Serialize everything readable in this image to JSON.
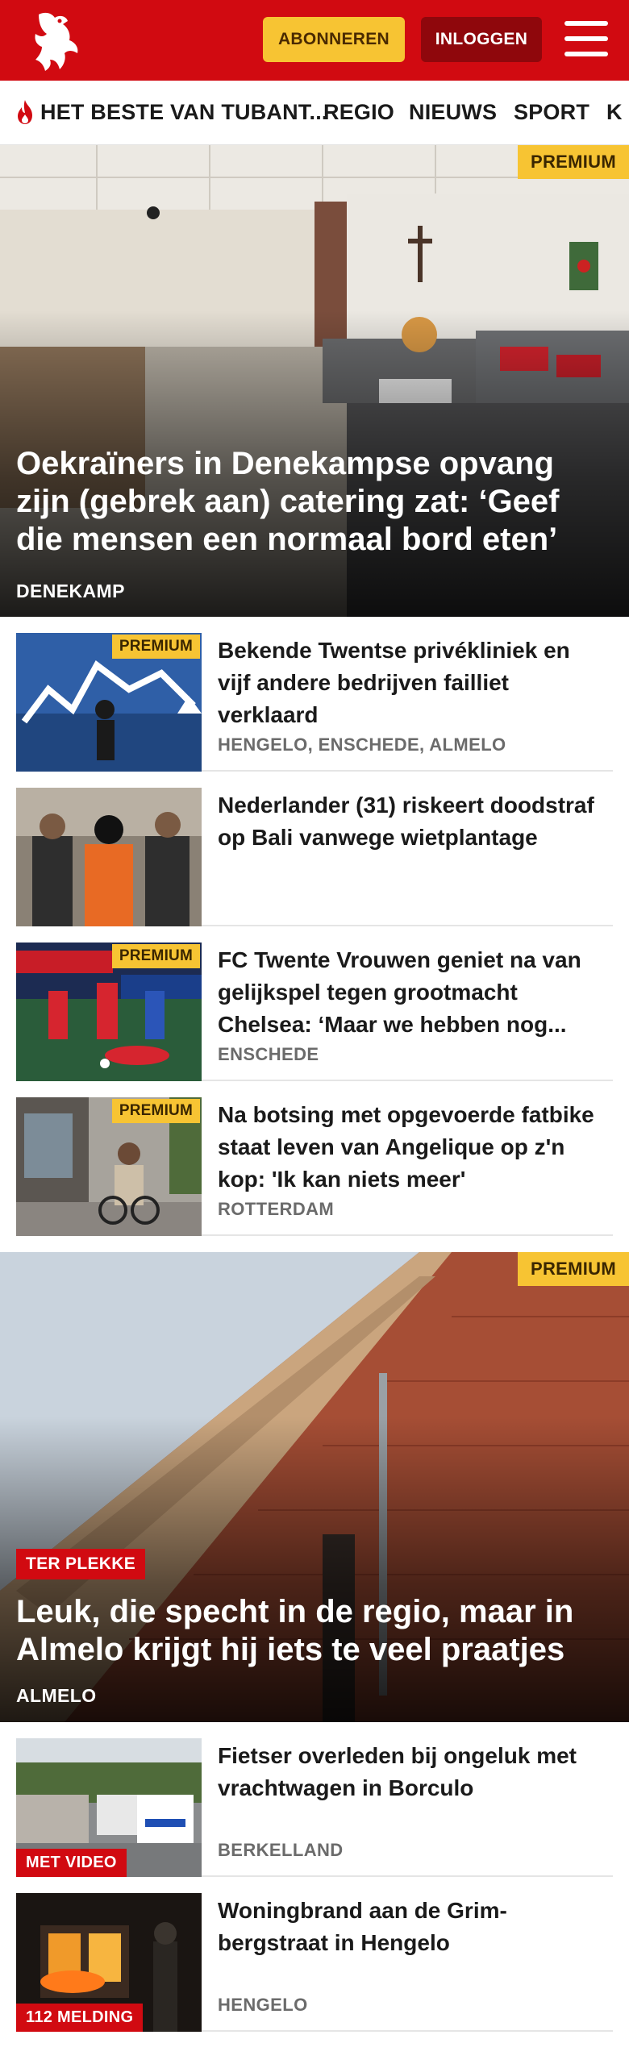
{
  "header": {
    "subscribe_label": "ABONNEREN",
    "login_label": "INLOGGEN",
    "brand_color": "#d10a11",
    "subscribe_color": "#f7c433"
  },
  "nav": {
    "items": [
      {
        "label": "HET BESTE VAN TUBANT...",
        "icon": "flame-icon"
      },
      {
        "label": "REGIO"
      },
      {
        "label": "NIEUWS"
      },
      {
        "label": "SPORT"
      },
      {
        "label": "K"
      }
    ]
  },
  "articles": [
    {
      "kind": "hero",
      "premium": "PREMIUM",
      "title": "Oekraïners in Denekampse opvang zijn (gebrek aan) catering zat: ‘Geef die mensen een normaal bord eten’",
      "location": "DENEKAMP"
    },
    {
      "kind": "row",
      "premium": "PREMIUM",
      "title": "Bekende Twentse privékliniek en vijf andere bedrijven failliet verklaard",
      "location": "HENGELO, ENSCHEDE, ALMELO"
    },
    {
      "kind": "row",
      "title": "Nederlander (31) riskeert doodstraf op Bali vanwege wietplantage",
      "location": ""
    },
    {
      "kind": "row",
      "premium": "PREMIUM",
      "title": "FC Twente Vrouwen geniet na van gelijkspel tegen grootmacht Chelsea: ‘Maar we hebben nog...",
      "location": "ENSCHEDE"
    },
    {
      "kind": "row",
      "premium": "PREMIUM",
      "title": "Na botsing met opgevoerde fatbike staat leven van Angelique op z'n kop: 'Ik kan niets meer'",
      "location": "ROTTERDAM"
    },
    {
      "kind": "hero",
      "premium": "PREMIUM",
      "label": "TER PLEKKE",
      "title": "Leuk, die specht in de regio, maar in Almelo krijgt hij iets te veel praatjes",
      "location": "ALMELO"
    },
    {
      "kind": "row",
      "badge": "MET VIDEO",
      "title": "Fietser overleden bij ongeluk met vrachtwagen in Borculo",
      "location": "BERKELLAND"
    },
    {
      "kind": "row",
      "badge": "112 MELDING",
      "title": "Woningbrand aan de Grim­bergstraat in Hengelo",
      "location": "HENGELO"
    }
  ]
}
